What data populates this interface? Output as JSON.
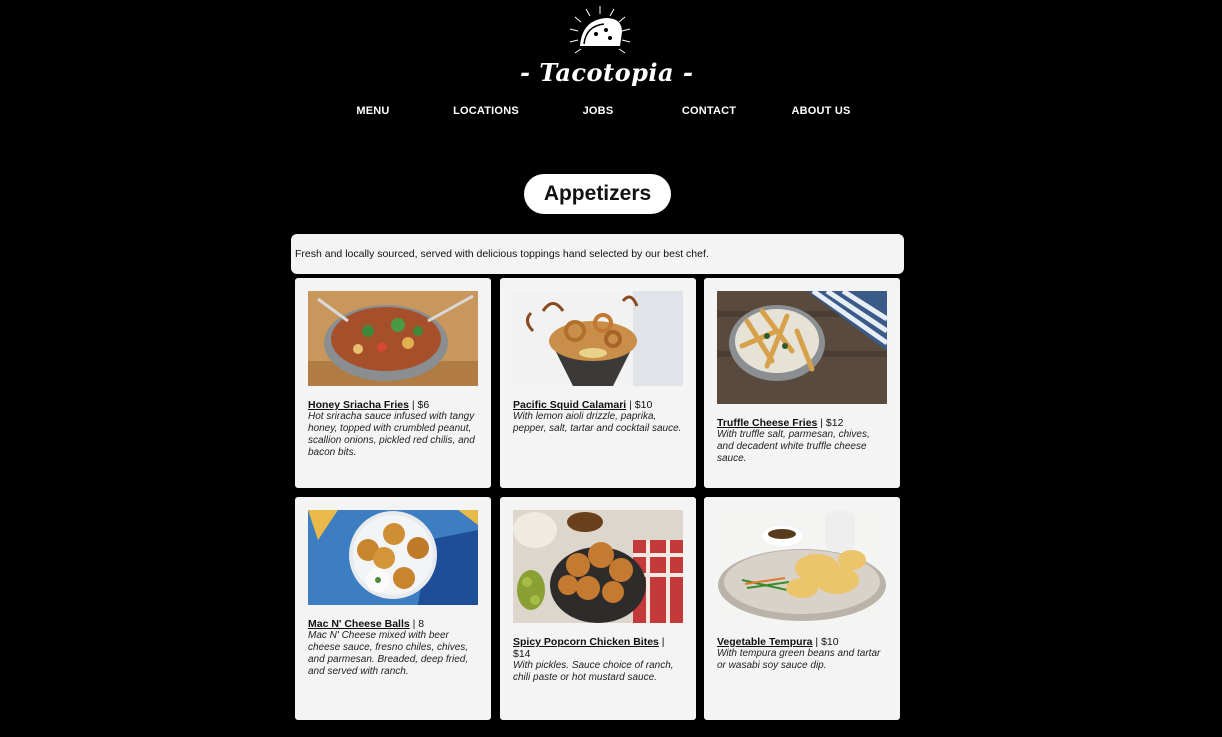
{
  "brand": {
    "name": "- Tacotopia -"
  },
  "nav": [
    {
      "label": "MENU"
    },
    {
      "label": "LOCATIONS"
    },
    {
      "label": "JOBS"
    },
    {
      "label": "CONTACT"
    },
    {
      "label": "ABOUT US"
    }
  ],
  "section": {
    "title": "Appetizers",
    "description": "Fresh and locally sourced, served with delicious toppings hand selected by our best chef."
  },
  "items": [
    {
      "name": "Honey Sriacha Fries",
      "price": " | $6",
      "description": "Hot sriracha sauce infused with tangy honey, topped with crumbled peanut, scallion onions, pickled red chilis, and bacon bits."
    },
    {
      "name": "Pacific Squid Calamari",
      "price": " | $10",
      "description": "With lemon aioli drizzle, paprika, pepper, salt, tartar and cocktail sauce."
    },
    {
      "name": "Truffle Cheese Fries",
      "price": " | $12",
      "description": "With truffle salt, parmesan, chives, and decadent white truffle cheese sauce."
    },
    {
      "name": "Mac N' Cheese Balls",
      "price": " | 8",
      "description": "Mac N' Cheese mixed with beer cheese sauce, fresno chiles, chives, and parmesan. Breaded, deep fried, and served with ranch."
    },
    {
      "name": "Spicy Popcorn Chicken Bites",
      "price": " | $14",
      "description": "With pickles. Sauce choice of ranch, chili paste or hot mustard sauce."
    },
    {
      "name": "Vegetable Tempura",
      "price": " | $10",
      "description": "With tempura green beans and tartar or wasabi soy sauce dip."
    }
  ]
}
